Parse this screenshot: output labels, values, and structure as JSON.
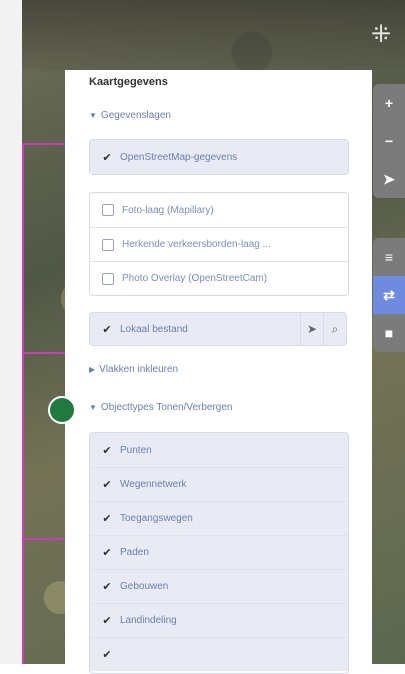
{
  "panel": {
    "title": "Kaartgegevens",
    "section_data_layers": "Gegevenslagen",
    "osm_layer": "OpenStreetMap-gegevens",
    "photo_layers": [
      "Foto-laag (Mapillary)",
      "Herkende verkeersborden-laag ...",
      "Photo Overlay (OpenStreetCam)"
    ],
    "local_file": "Lokaal bestand",
    "section_fill": "Vlakken inkleuren",
    "section_types": "Objecttypes Tonen/Verbergen",
    "feature_types": [
      "Punten",
      "Wegennetwerk",
      "Toegangswegen",
      "Paden",
      "Gebouwen",
      "Landindeling",
      ""
    ]
  },
  "toolbar": {
    "zoom_in": "+",
    "zoom_out": "−",
    "locate": "➤",
    "layers": "≡",
    "map_data": "⇄",
    "issues": "■"
  },
  "icons": {
    "check": "✔",
    "locate_layer": "➤",
    "search": "⌕",
    "spinner": "⁜"
  }
}
